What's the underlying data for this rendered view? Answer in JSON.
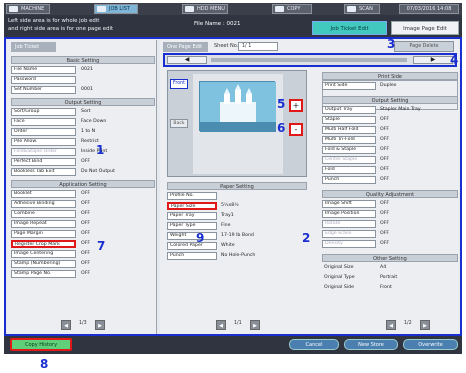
{
  "top_tabs": [
    {
      "label": "MACHINE"
    },
    {
      "label": "JOB LIST"
    },
    {
      "label": "HDD MENU"
    },
    {
      "label": "COPY"
    },
    {
      "label": "SCAN"
    }
  ],
  "clock": "07/03/2016 14:08",
  "header": {
    "message_line1": "Left side area is for whole job edit",
    "message_line2": "and right side area is for one page edit",
    "file_name_label": "File Name : 0021",
    "tab_job_ticket": "Job Ticket Edit",
    "tab_image_page": "Image Page Edit"
  },
  "job_ticket": {
    "title": "Job Ticket"
  },
  "basic_setting": {
    "title": "Basic Setting",
    "rows": [
      {
        "label": "File Name",
        "value": "0021"
      },
      {
        "label": "Password",
        "value": ""
      },
      {
        "label": "Set Number",
        "value": "0001"
      }
    ]
  },
  "output_setting": {
    "title": "Output Setting",
    "rows": [
      {
        "label": "Sort/Group",
        "value": "Sort"
      },
      {
        "label": "Face",
        "value": "Face Down"
      },
      {
        "label": "Order",
        "value": "1 to N"
      },
      {
        "label": "Pile Allow.",
        "value": "Restrict"
      },
      {
        "label": "Fold&Staple Order",
        "value": "Inside Print"
      },
      {
        "label": "Perfect Bind",
        "value": "OFF"
      },
      {
        "label": "Bookless Tab Exit",
        "value": "Do Not Output"
      }
    ]
  },
  "application_setting": {
    "title": "Application Setting",
    "rows": [
      {
        "label": "Booklet",
        "value": "OFF"
      },
      {
        "label": "Adhesive Binding",
        "value": "OFF"
      },
      {
        "label": "Combine",
        "value": "OFF"
      },
      {
        "label": "Image Repeat",
        "value": "OFF"
      },
      {
        "label": "Page Margin",
        "value": "OFF"
      },
      {
        "label": "Register Crop Mark",
        "value": "OFF"
      },
      {
        "label": "Image Centering",
        "value": "OFF"
      },
      {
        "label": "Stamp (Numbering)",
        "value": "OFF"
      },
      {
        "label": "Stamp  Page No.",
        "value": "OFF"
      }
    ]
  },
  "left_pager": "1/3",
  "page_edit": {
    "title": "One Page Edit",
    "sheet_label": "Sheet No.",
    "sheet_value": "1/    1",
    "page_delete": "Page Delete",
    "front": "Front",
    "back": "Back",
    "zoom_in": "+",
    "zoom_out": "-"
  },
  "print_side": {
    "title": "Print Side",
    "rows": [
      {
        "label": "Print Side",
        "value": "Duplex"
      }
    ]
  },
  "output_setting_r": {
    "title": "Output Setting",
    "rows": [
      {
        "label": "Output Tray",
        "value": "Stapler Main Tray"
      },
      {
        "label": "Staple",
        "value": "OFF"
      },
      {
        "label": "Multi Half Fold",
        "value": "OFF"
      },
      {
        "label": "Multi Tri-Fold",
        "value": "OFF"
      },
      {
        "label": "Fold & Staple",
        "value": "OFF"
      },
      {
        "label": "Center Staple",
        "value": "OFF"
      },
      {
        "label": "Fold",
        "value": "OFF"
      },
      {
        "label": "Punch",
        "value": "OFF"
      }
    ]
  },
  "quality": {
    "title": "Quality Adjustment",
    "rows": [
      {
        "label": "Image Shift",
        "value": "OFF"
      },
      {
        "label": "Image Position",
        "value": "OFF"
      },
      {
        "label": "Rotate",
        "value": "OFF"
      },
      {
        "label": "Edge Erase",
        "value": "OFF"
      },
      {
        "label": "Density",
        "value": "OFF"
      }
    ]
  },
  "other": {
    "title": "Other Setting",
    "rows": [
      {
        "label": "Original Size",
        "value": "A4"
      },
      {
        "label": "Original Type",
        "value": "Portrait"
      },
      {
        "label": "Original Side",
        "value": "Front"
      }
    ]
  },
  "right_pager": "1/2",
  "paper": {
    "title": "Paper Setting",
    "rows": [
      {
        "label": "Profile No.",
        "value": ""
      },
      {
        "label": "Paper Size",
        "value": "5½x8½"
      },
      {
        "label": "Paper Tray",
        "value": "Tray1"
      },
      {
        "label": "Paper Type",
        "value": "Fine"
      },
      {
        "label": "Weight",
        "value": "17-19 lb Bond"
      },
      {
        "label": "Colored Paper",
        "value": "White"
      },
      {
        "label": "Punch",
        "value": "No Hole-Punch"
      }
    ]
  },
  "middle_pager": "1/1",
  "bottom": {
    "copy_history": "Copy History",
    "cancel": "Cancel",
    "new_store": "New Store",
    "overwrite": "Overwrite"
  },
  "callouts": [
    "1",
    "2",
    "3",
    "4",
    "5",
    "6",
    "7",
    "8",
    "9"
  ]
}
